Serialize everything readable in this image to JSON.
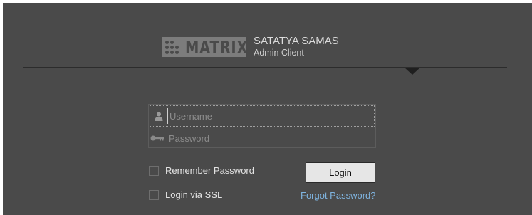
{
  "brand": {
    "logo_text": "MATRIX",
    "product_name": "SATATYA SAMAS",
    "product_sub": "Admin Client"
  },
  "login_form": {
    "username_placeholder": "Username",
    "password_placeholder": "Password",
    "remember_label": "Remember Password",
    "ssl_label": "Login via SSL",
    "login_button": "Login",
    "forgot_link": "Forgot Password?"
  },
  "icons": {
    "username": "user-icon",
    "password": "key-icon",
    "divider": "caret-down-icon"
  },
  "colors": {
    "background": "#4a4a4a",
    "link": "#7fb4e0",
    "button": "#e6e6e6"
  }
}
